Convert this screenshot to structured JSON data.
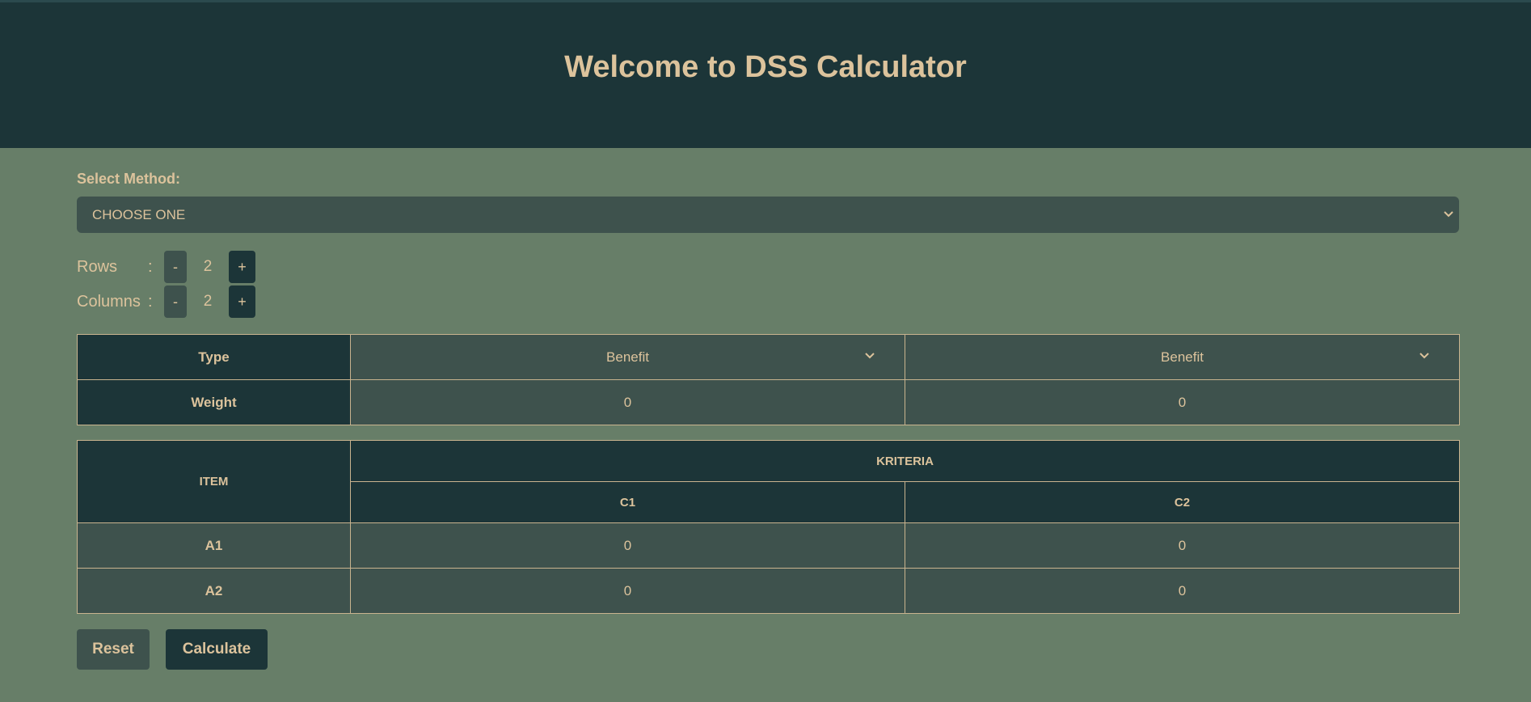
{
  "header": {
    "title": "Welcome to DSS Calculator"
  },
  "method": {
    "label": "Select Method:",
    "selected": "CHOOSE ONE"
  },
  "rows": {
    "label": "Rows",
    "colon": ":",
    "minus": "-",
    "value": "2",
    "plus": "+"
  },
  "columns": {
    "label": "Columns",
    "colon": ":",
    "minus": "-",
    "value": "2",
    "plus": "+"
  },
  "criteria_table": {
    "type_label": "Type",
    "weight_label": "Weight",
    "types": [
      "Benefit",
      "Benefit"
    ],
    "weights": [
      "0",
      "0"
    ]
  },
  "matrix": {
    "item_header": "ITEM",
    "kriteria_header": "KRITERIA",
    "columns": [
      "C1",
      "C2"
    ],
    "rows": [
      {
        "name": "A1",
        "values": [
          "0",
          "0"
        ]
      },
      {
        "name": "A2",
        "values": [
          "0",
          "0"
        ]
      }
    ]
  },
  "actions": {
    "reset": "Reset",
    "calculate": "Calculate"
  },
  "colors": {
    "dark": "#1c3538",
    "mid": "#3e524d",
    "background": "#677e68",
    "text": "#dcc39c"
  }
}
